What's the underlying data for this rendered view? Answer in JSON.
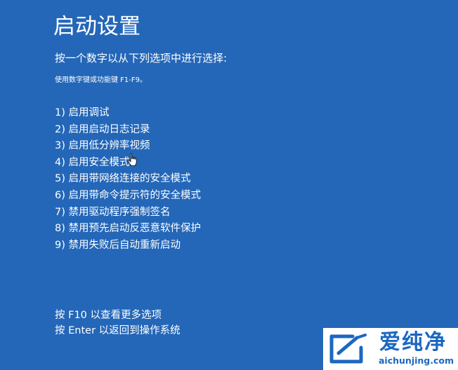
{
  "colors": {
    "background": "#2467B8",
    "text": "#FFFFFF",
    "watermark_background": "#FFFFFF",
    "watermark_accent": "#1B67C2"
  },
  "screen": {
    "title": "启动设置",
    "prompt": "按一个数字以从下列选项中进行选择:",
    "hint": "使用数字键或功能键 F1-F9。"
  },
  "options": [
    {
      "label": "1) 启用调试"
    },
    {
      "label": "2) 启用启动日志记录"
    },
    {
      "label": "3) 启用低分辨率视频"
    },
    {
      "label": "4) 启用安全模式"
    },
    {
      "label": "5) 启用带网络连接的安全模式"
    },
    {
      "label": "6) 启用带命令提示符的安全模式"
    },
    {
      "label": "7) 禁用驱动程序强制签名"
    },
    {
      "label": "8) 禁用预先启动反恶意软件保护"
    },
    {
      "label": "9) 禁用失败后自动重新启动"
    }
  ],
  "footer": {
    "more_options": "按 F10 以查看更多选项",
    "return_os": "按 Enter 以返回到操作系统"
  },
  "cursor": {
    "icon": "hand-pointer-icon"
  },
  "watermark": {
    "icon": "aichunjing-logo-icon",
    "name": "爱纯净",
    "url": "aichunjing.com"
  }
}
